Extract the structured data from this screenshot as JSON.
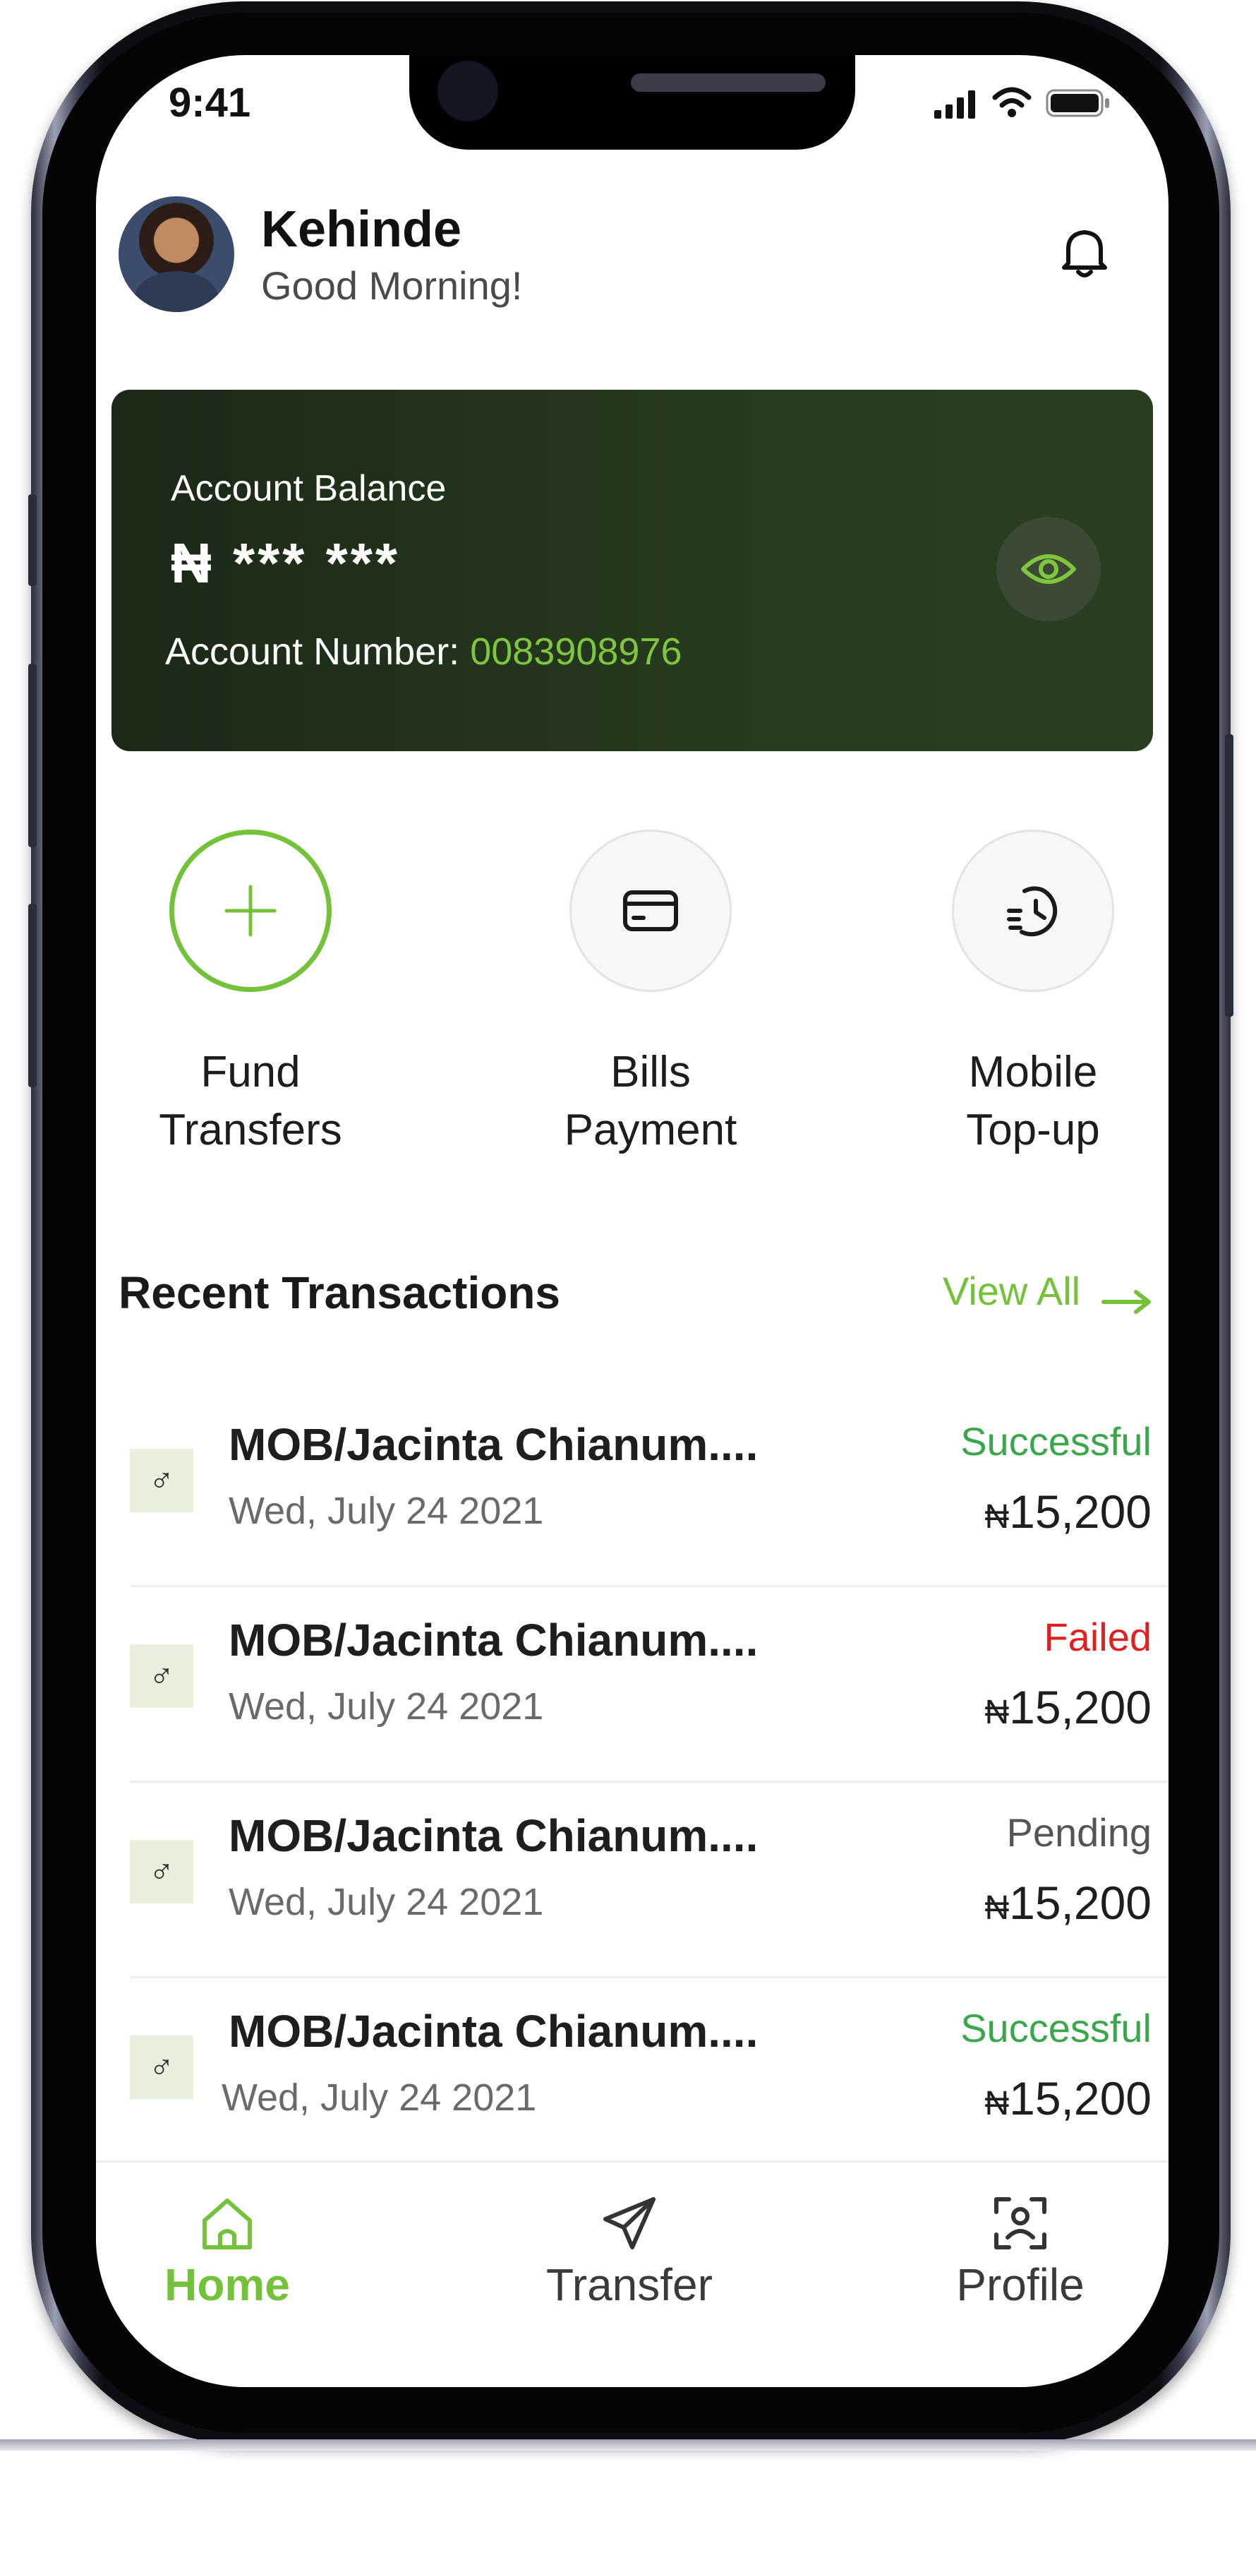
{
  "status_bar": {
    "time": "9:41"
  },
  "header": {
    "user_name": "Kehinde",
    "greeting": "Good Morning!",
    "avatar_icon": "user-avatar-photo",
    "bell_icon": "bell-icon"
  },
  "balance_card": {
    "label": "Account Balance",
    "currency_symbol": "₦",
    "balance_masked": "*** ***",
    "account_number_label": "Account Number: ",
    "account_number": "0083908976",
    "toggle_icon": "eye-icon"
  },
  "quick_actions": [
    {
      "line1": "Fund",
      "line2": "Transfers",
      "icon": "plus-icon"
    },
    {
      "line1": "Bills",
      "line2": "Payment",
      "icon": "card-icon"
    },
    {
      "line1": "Mobile",
      "line2": "Top-up",
      "icon": "history-clock-icon"
    }
  ],
  "recent_transactions": {
    "title": "Recent Transactions",
    "view_all": "View All",
    "items": [
      {
        "icon_glyph": "♂",
        "title": "MOB/Jacinta Chianum....",
        "date": "Wed, July 24 2021",
        "status": "Successful",
        "currency": "₦",
        "amount": "15,200"
      },
      {
        "icon_glyph": "♂",
        "title": "MOB/Jacinta Chianum....",
        "date": "Wed, July 24 2021",
        "status": "Failed",
        "currency": "₦",
        "amount": "15,200"
      },
      {
        "icon_glyph": "♂",
        "title": "MOB/Jacinta Chianum....",
        "date": "Wed, July 24 2021",
        "status": "Pending",
        "currency": "₦",
        "amount": "15,200"
      },
      {
        "icon_glyph": "♂",
        "title": "MOB/Jacinta Chianum....",
        "date": "Wed, July 24 2021",
        "status": "Successful",
        "currency": "₦",
        "amount": "15,200"
      }
    ]
  },
  "tab_bar": {
    "tabs": [
      {
        "label": "Home",
        "icon": "home-icon",
        "active": true
      },
      {
        "label": "Transfer",
        "icon": "send-icon",
        "active": false
      },
      {
        "label": "Profile",
        "icon": "face-scan-icon",
        "active": false
      }
    ]
  },
  "colors": {
    "accent_green": "#74c23a",
    "card_background": "#223319",
    "status_successful": "#3aa84a",
    "status_failed": "#e0201f",
    "status_pending": "#555555"
  }
}
